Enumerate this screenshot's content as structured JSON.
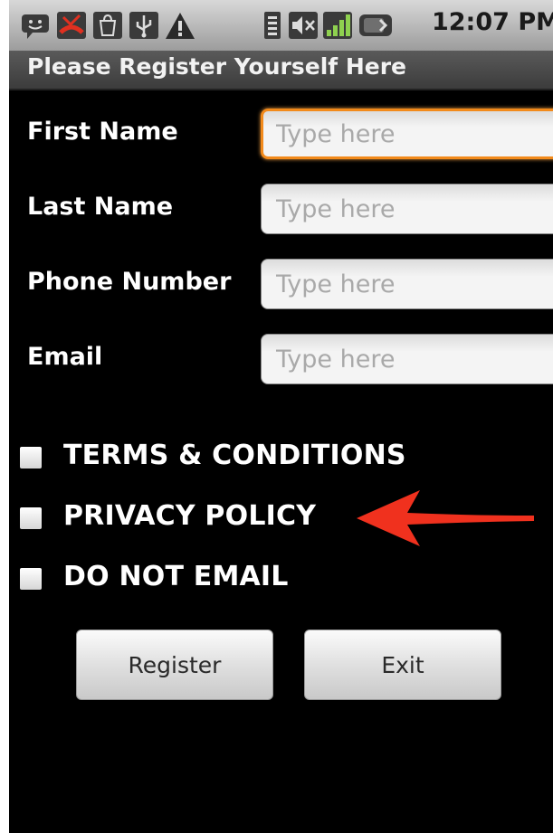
{
  "status_bar": {
    "time": "12:07 PM",
    "icons": [
      "chat-smiley-icon",
      "missed-call-icon",
      "market-bag-icon",
      "usb-icon",
      "warning-icon",
      "wifi-icon",
      "volume-muted-icon",
      "signal-icon",
      "battery-icon"
    ]
  },
  "title": "Please Register Yourself Here",
  "form": {
    "fields": [
      {
        "label": "First Name",
        "placeholder": "Type here",
        "value": ""
      },
      {
        "label": "Last Name",
        "placeholder": "Type here",
        "value": ""
      },
      {
        "label": "Phone Number",
        "placeholder": "Type here",
        "value": ""
      },
      {
        "label": "Email",
        "placeholder": "Type here",
        "value": ""
      }
    ],
    "focused_field": "First Name",
    "focus_color": "#f28a1b"
  },
  "checkboxes": [
    {
      "label": "TERMS & CONDITIONS",
      "checked": false
    },
    {
      "label": "PRIVACY POLICY",
      "checked": false
    },
    {
      "label": "DO NOT EMAIL",
      "checked": false
    }
  ],
  "annotation": {
    "icon": "red-arrow-icon",
    "color": "#f0311e",
    "points_to": "PRIVACY POLICY"
  },
  "buttons": {
    "register": "Register",
    "exit": "Exit"
  }
}
